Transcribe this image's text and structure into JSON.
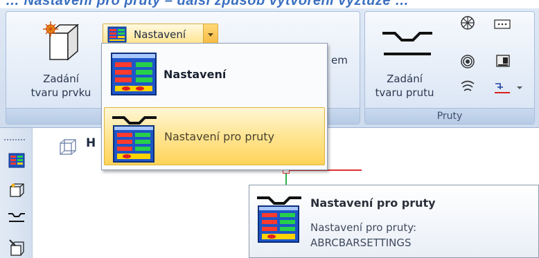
{
  "title_fragment": "… Nastavení pro pruty – další způsob vytvoření výztuže …",
  "ribbon": {
    "group1": {
      "big_button_label_line1": "Zadání",
      "big_button_label_line2": "tvaru prvku",
      "hidden_label_fragment": "em"
    },
    "dropdown": {
      "label": "Nastavení",
      "icon": "settings-grid-icon"
    },
    "group2": {
      "big_button_label_line1": "Zadání",
      "big_button_label_line2": "tvaru prutu",
      "panel_label": "Pruty",
      "small_icons": [
        "spiral-pattern-icon",
        "dotted-box-icon",
        "concentric-rings-icon",
        "chip-icon",
        "wave-icon",
        "red-symbol-icon"
      ]
    }
  },
  "menu": {
    "items": [
      {
        "label": "Nastavení",
        "icon": "settings-grid-icon"
      },
      {
        "label": "Nastavení pro pruty",
        "icon": "bar-settings-icon"
      }
    ]
  },
  "workspace": {
    "tab_fragment": "H",
    "toolbar_icons": [
      "settings-grid-icon",
      "box-edit-icon",
      "bar-shape-icon",
      "box-cut-icon"
    ]
  },
  "tooltip": {
    "title": "Nastavení pro pruty",
    "desc_line1": "Nastavení pro pruty:",
    "desc_line2": "ABRCBARSETTINGS"
  },
  "colors": {
    "accent": "#3a6fc0",
    "highlight": "#ffe592",
    "ribbon_bg": "#dfe8f5"
  }
}
